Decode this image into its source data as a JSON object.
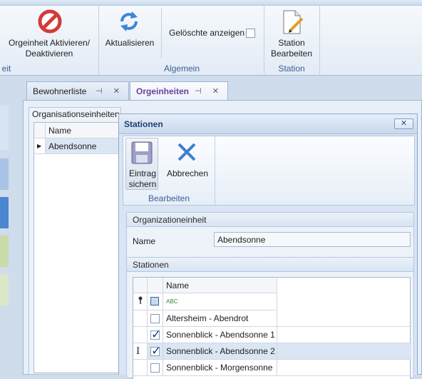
{
  "ribbon": {
    "activate_label": "Orgeinheit Aktivieren/\nDeaktivieren",
    "group1_label": "eit",
    "refresh_label": "Aktualisieren",
    "show_deleted_label": "Gelöschte anzeigen",
    "group2_label": "Algemein",
    "edit_station_label": "Station\nBearbeiten",
    "group3_label": "Station"
  },
  "tabs": [
    {
      "label": "Bewohnerliste"
    },
    {
      "label": "Orgeinheiten"
    }
  ],
  "tab_icons": "⊣ ✕",
  "bg_panel": {
    "title": "Organisationseinheiten",
    "col_header": "Name",
    "row_marker": "▶",
    "row_value": "Abendsonne"
  },
  "dialog": {
    "title": "Stationen",
    "close": "✕",
    "save_label": "Eintrag\nsichern",
    "cancel_label": "Abbrechen",
    "group_label": "Bearbeiten",
    "org_group_title": "Organizationeinheit",
    "name_label": "Name",
    "name_value": "Abendsonne",
    "stations_group_title": "Stationen",
    "grid_header": "Name",
    "filter_icon": "ABC",
    "rows": [
      {
        "name": "Altersheim - Abendrot",
        "checked": false
      },
      {
        "name": "Sonnenblick - Abendsonne 1",
        "checked": true
      },
      {
        "name": "Sonnenblick - Abendsonne 2",
        "checked": true
      },
      {
        "name": "Sonnenblick - Morgensonne",
        "checked": false
      }
    ],
    "cursor_glyph": "I"
  }
}
